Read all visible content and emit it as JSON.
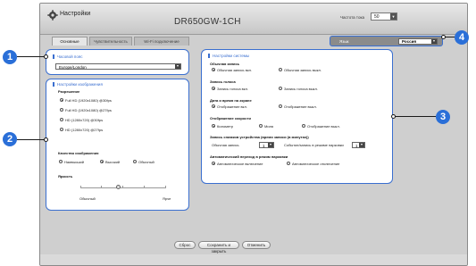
{
  "app": {
    "title": "Настройки",
    "device": "DR650GW-1CH"
  },
  "header": {
    "freq_label": "Частота тока",
    "freq_value": "50"
  },
  "language": {
    "label": "Язык",
    "value": "Россия"
  },
  "tabs": [
    "Основные",
    "Чувствительность",
    "Wi-Fi подключение"
  ],
  "timezone": {
    "title": "Часовой пояс",
    "value": "Europe/London"
  },
  "image": {
    "title": "Настройки изображения",
    "resolution_label": "Разрешение",
    "resolutions": [
      "Full HD (1920x1080) @30fps",
      "Full HD (1920x1080) @27fps",
      "HD (1280x720) @30fps",
      "HD (1280x720) @27fps"
    ],
    "quality_label": "Качество изображения",
    "quality_options": [
      "Наивысший",
      "Высокий",
      "Обычный"
    ],
    "brightness_label": "Яркость",
    "brightness_min": "Обычный",
    "brightness_max": "Ярче",
    "brightness_level": 0.45
  },
  "system": {
    "title": "Настройки системы",
    "record_label": "Обычная запись",
    "record_options": [
      "Обычная запись вкл.",
      "Обычная запись выкл."
    ],
    "audio_label": "Запись голоса",
    "audio_options": [
      "Запись голоса вкл.",
      "Запись голоса выкл."
    ],
    "datetime_label": "Дата и время на экране",
    "datetime_options": [
      "Отображение вкл.",
      "Отображение выкл."
    ],
    "speed_label": "Отображение скорости",
    "speed_options": [
      "Километр",
      "Миля",
      "Отображение выкл."
    ],
    "delay_label": "Запись снимков устройства (время записи (в минутах))",
    "delay_normal_label": "Обычная запись",
    "delay_normal_value": "1",
    "delay_event_label": "Событие/запись в режиме парковки",
    "delay_event_value": "1",
    "auto_label": "Автоматический переход в режим парковки",
    "auto_options": [
      "Автоматическое включение",
      "Автоматическое отключение"
    ]
  },
  "buttons": {
    "ok": "Сброс",
    "save": "Сохранить и закрыть",
    "cancel": "Отменить"
  },
  "callouts": [
    "1",
    "2",
    "3",
    "4"
  ],
  "colors": {
    "callout": "#2a6fd8",
    "panel_border": "#3a6fd0"
  }
}
